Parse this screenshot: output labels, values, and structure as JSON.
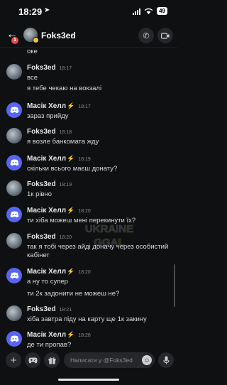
{
  "status_bar": {
    "time": "18:29",
    "battery": "49"
  },
  "header": {
    "back_badge": "1",
    "title": "Foks3ed"
  },
  "composer": {
    "placeholder": "Написати у @Foks3ed"
  },
  "watermark": {
    "line1": "UKRAINE",
    "line2": "GGAL"
  },
  "messages": [
    {
      "kind": "cont",
      "text": "оке"
    },
    {
      "kind": "user",
      "author": "Foks3ed",
      "time": "18:17",
      "lines": [
        "все",
        "я тебе чекаю на вокзалі"
      ]
    },
    {
      "kind": "discord",
      "author": "Масік Хелл",
      "time": "18:17",
      "lines": [
        "зараз прийду"
      ]
    },
    {
      "kind": "user",
      "author": "Foks3ed",
      "time": "18:18",
      "lines": [
        "я возле банкомата жду"
      ]
    },
    {
      "kind": "discord",
      "author": "Масік Хелл",
      "time": "18:19",
      "lines": [
        "скільки всього маєш донату?"
      ]
    },
    {
      "kind": "user",
      "author": "Foks3ed",
      "time": "18:19",
      "lines": [
        "1к рівно"
      ]
    },
    {
      "kind": "discord",
      "author": "Масік Хелл",
      "time": "18:20",
      "lines": [
        "ти хіба можеш мені перекинути їх?"
      ]
    },
    {
      "kind": "user",
      "author": "Foks3ed",
      "time": "18:20",
      "lines": [
        "так я тобі через айді доначу через особистий кабінет"
      ]
    },
    {
      "kind": "discord",
      "author": "Масік Хелл",
      "time": "18:20",
      "lines": [
        "а ну то супер",
        "ти 2к задонити не можеш не?"
      ]
    },
    {
      "kind": "user",
      "author": "Foks3ed",
      "time": "18:21",
      "lines": [
        "хіба завтра піду на карту ще 1к закину"
      ]
    },
    {
      "kind": "discord",
      "author": "Масік Хелл",
      "time": "18:28",
      "lines": [
        "де ти пропав?"
      ]
    }
  ]
}
